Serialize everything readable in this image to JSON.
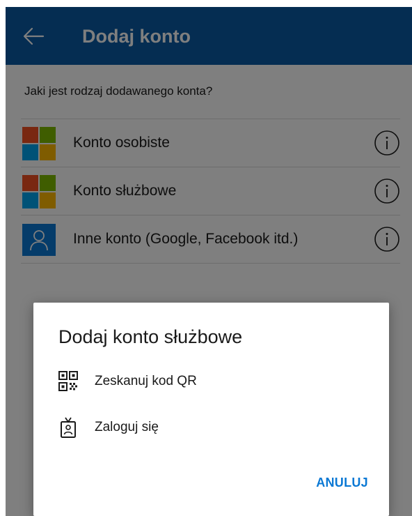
{
  "header": {
    "title": "Dodaj konto",
    "back_icon": "arrow-left-icon"
  },
  "main": {
    "question": "Jaki jest rodzaj dodawanego konta?",
    "account_types": [
      {
        "label": "Konto osobiste",
        "icon": "microsoft-logo-icon",
        "info_icon": "info-icon"
      },
      {
        "label": "Konto służbowe",
        "icon": "microsoft-logo-icon",
        "info_icon": "info-icon"
      },
      {
        "label": "Inne konto (Google, Facebook itd.)",
        "icon": "user-icon",
        "info_icon": "info-icon"
      }
    ]
  },
  "dialog": {
    "title": "Dodaj konto służbowe",
    "options": [
      {
        "label": "Zeskanuj kod QR",
        "icon": "qr-code-icon"
      },
      {
        "label": "Zaloguj się",
        "icon": "badge-icon"
      }
    ],
    "cancel_label": "ANULUJ"
  },
  "colors": {
    "brand_blue": "#0a5aa5",
    "accent_blue": "#0a78d4",
    "ms_red": "#f25022",
    "ms_green": "#7fba00",
    "ms_blue": "#00a4ef",
    "ms_yellow": "#ffb900"
  }
}
